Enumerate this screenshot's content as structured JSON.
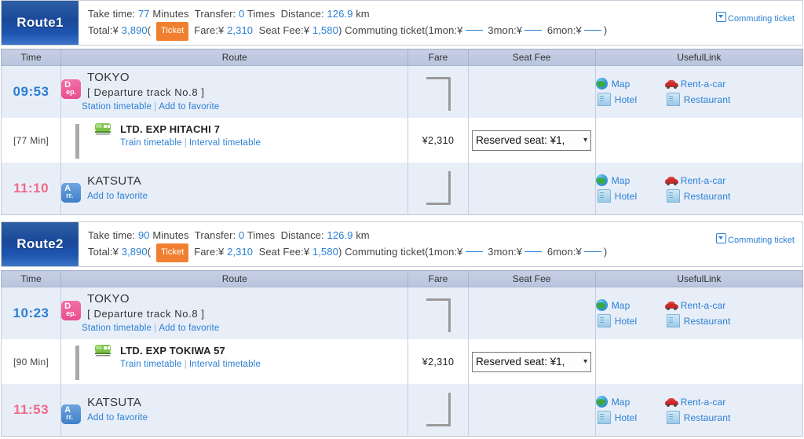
{
  "table_headers": {
    "time": "Time",
    "route": "Route",
    "fare": "Fare",
    "seat_fee": "Seat Fee",
    "useful_link": "UsefulLink"
  },
  "labels": {
    "take_time": "Take time:",
    "minutes": "Minutes",
    "transfer": "Transfer:",
    "times": "Times",
    "distance": "Distance:",
    "km": "km",
    "total": "Total:¥",
    "ticket": "Ticket",
    "fare_prefix": "Fare:¥",
    "seat_fee_prefix": "Seat Fee:¥",
    "commuting_open": "Commuting ticket(1mon:¥",
    "mon3": "3mon:¥",
    "mon6": "6mon:¥",
    "close_paren": ")",
    "open_paren": "(",
    "commuting_ticket_link": "Commuting ticket",
    "station_timetable": "Station timetable",
    "add_to_favorite": "Add to favorite",
    "train_timetable": "Train timetable",
    "interval_timetable": "Interval timetable",
    "map": "Map",
    "rent_a_car": "Rent-a-car",
    "hotel": "Hotel",
    "restaurant": "Restaurant",
    "dep_badge_top": "D",
    "dep_badge_bottom": "ep.",
    "arr_badge_top": "A",
    "arr_badge_bottom": "rr."
  },
  "colors": {
    "accent_blue": "#2a7fd4",
    "route_badge_blue": "#19489a",
    "ticket_orange": "#f08030",
    "dep_pink": "#ea4e90",
    "arr_blue": "#3f7fc8",
    "arrival_time_pink": "#f06a8a",
    "header_grey_blue": "#b9c4de",
    "row_bg_station": "#e8eef8"
  },
  "routes": [
    {
      "name": "Route1",
      "take_time": "77",
      "transfer": "0",
      "distance": "126.9",
      "total": "3,890",
      "fare": "2,310",
      "seat_fee": "1,580",
      "departure": {
        "time": "09:53",
        "station": "TOKYO",
        "track": "[ Departure track No.8 ]"
      },
      "leg": {
        "duration": "[77 Min]",
        "train_name": "LTD. EXP HITACHI 7",
        "fare": "¥2,310",
        "seat_option": "Reserved seat: ¥1,"
      },
      "arrival": {
        "time": "11:10",
        "station": "KATSUTA"
      }
    },
    {
      "name": "Route2",
      "take_time": "90",
      "transfer": "0",
      "distance": "126.9",
      "total": "3,890",
      "fare": "2,310",
      "seat_fee": "1,580",
      "departure": {
        "time": "10:23",
        "station": "TOKYO",
        "track": "[ Departure track No.8 ]"
      },
      "leg": {
        "duration": "[90 Min]",
        "train_name": "LTD. EXP TOKIWA 57",
        "fare": "¥2,310",
        "seat_option": "Reserved seat: ¥1,"
      },
      "arrival": {
        "time": "11:53",
        "station": "KATSUTA"
      }
    }
  ]
}
